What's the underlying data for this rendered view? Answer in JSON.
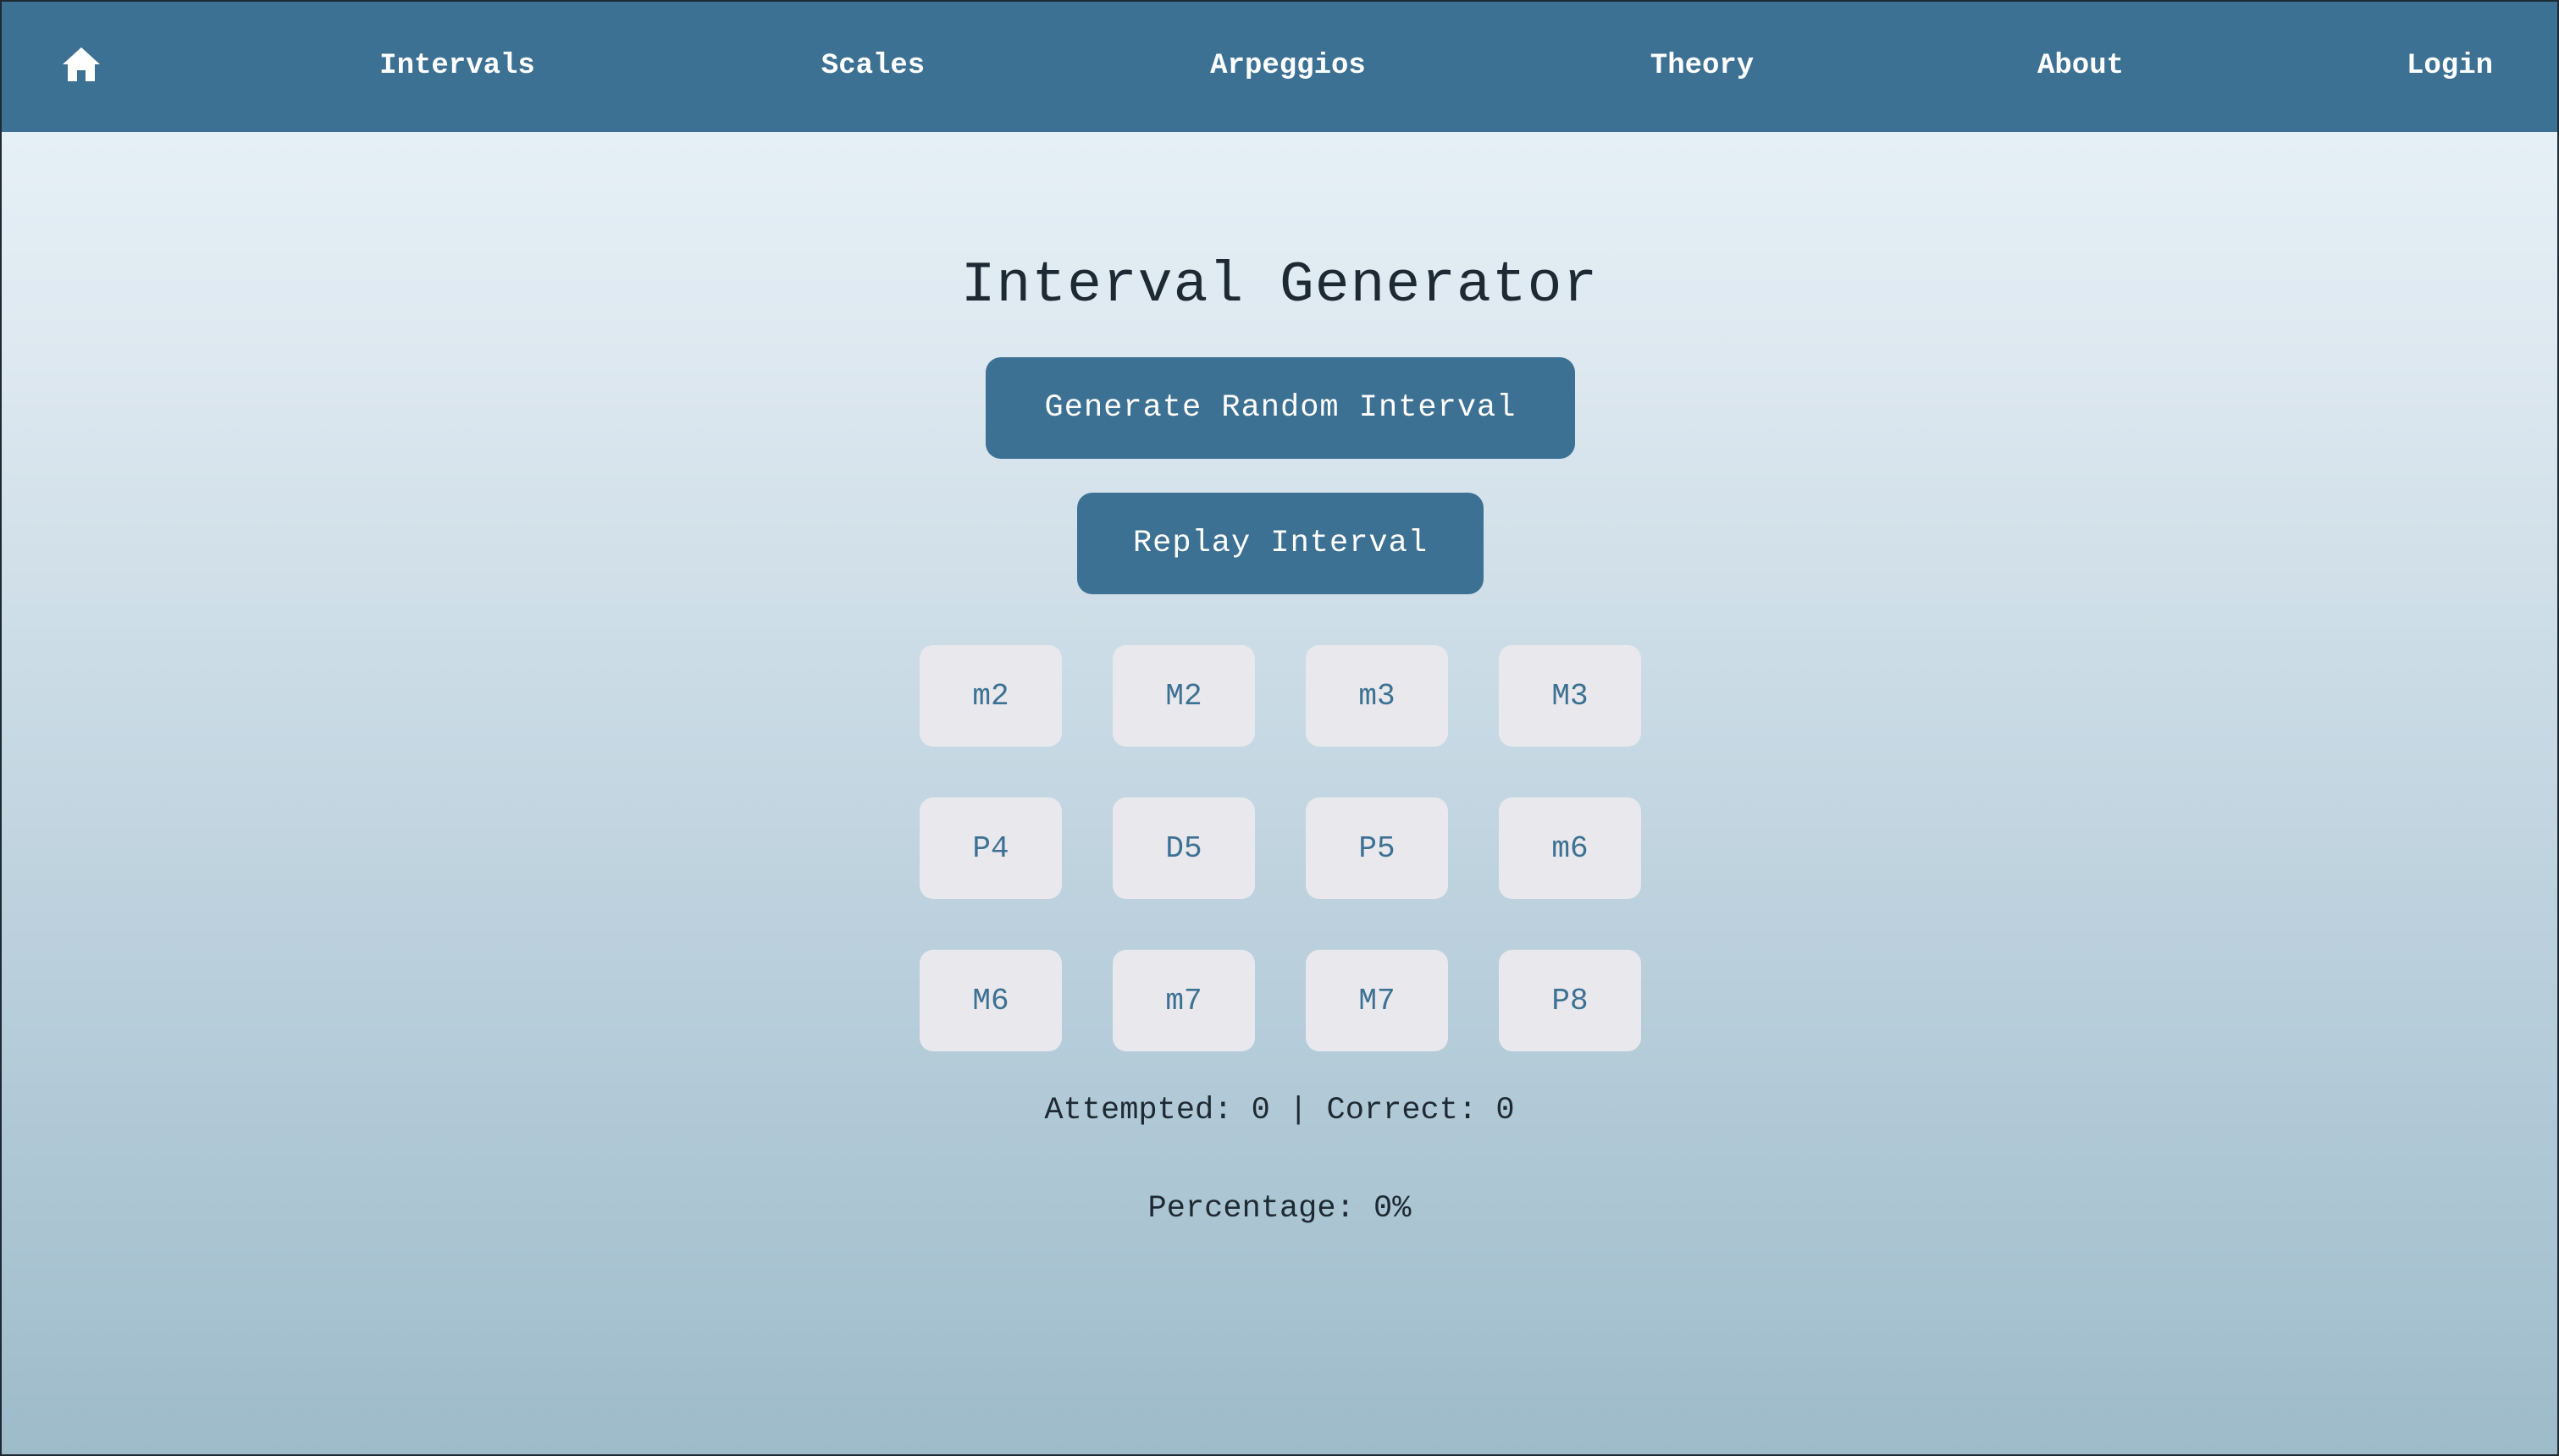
{
  "nav": {
    "home_icon": "home-icon",
    "items": [
      {
        "label": "Intervals"
      },
      {
        "label": "Scales"
      },
      {
        "label": "Arpeggios"
      },
      {
        "label": "Theory"
      },
      {
        "label": "About"
      },
      {
        "label": "Login"
      }
    ]
  },
  "main": {
    "title": "Interval Generator",
    "generate_button": "Generate Random Interval",
    "replay_button": "Replay Interval",
    "intervals": [
      "m2",
      "M2",
      "m3",
      "M3",
      "P4",
      "D5",
      "P5",
      "m6",
      "M6",
      "m7",
      "M7",
      "P8"
    ],
    "stats": {
      "attempted_label": "Attempted:",
      "attempted": "0",
      "separator": "|",
      "correct_label": "Correct:",
      "correct": "0",
      "percentage_label": "Percentage:",
      "percentage": "0%"
    }
  },
  "colors": {
    "accent": "#3d7193",
    "button_light": "#e8e8ed",
    "text_dark": "#1e2a33"
  }
}
